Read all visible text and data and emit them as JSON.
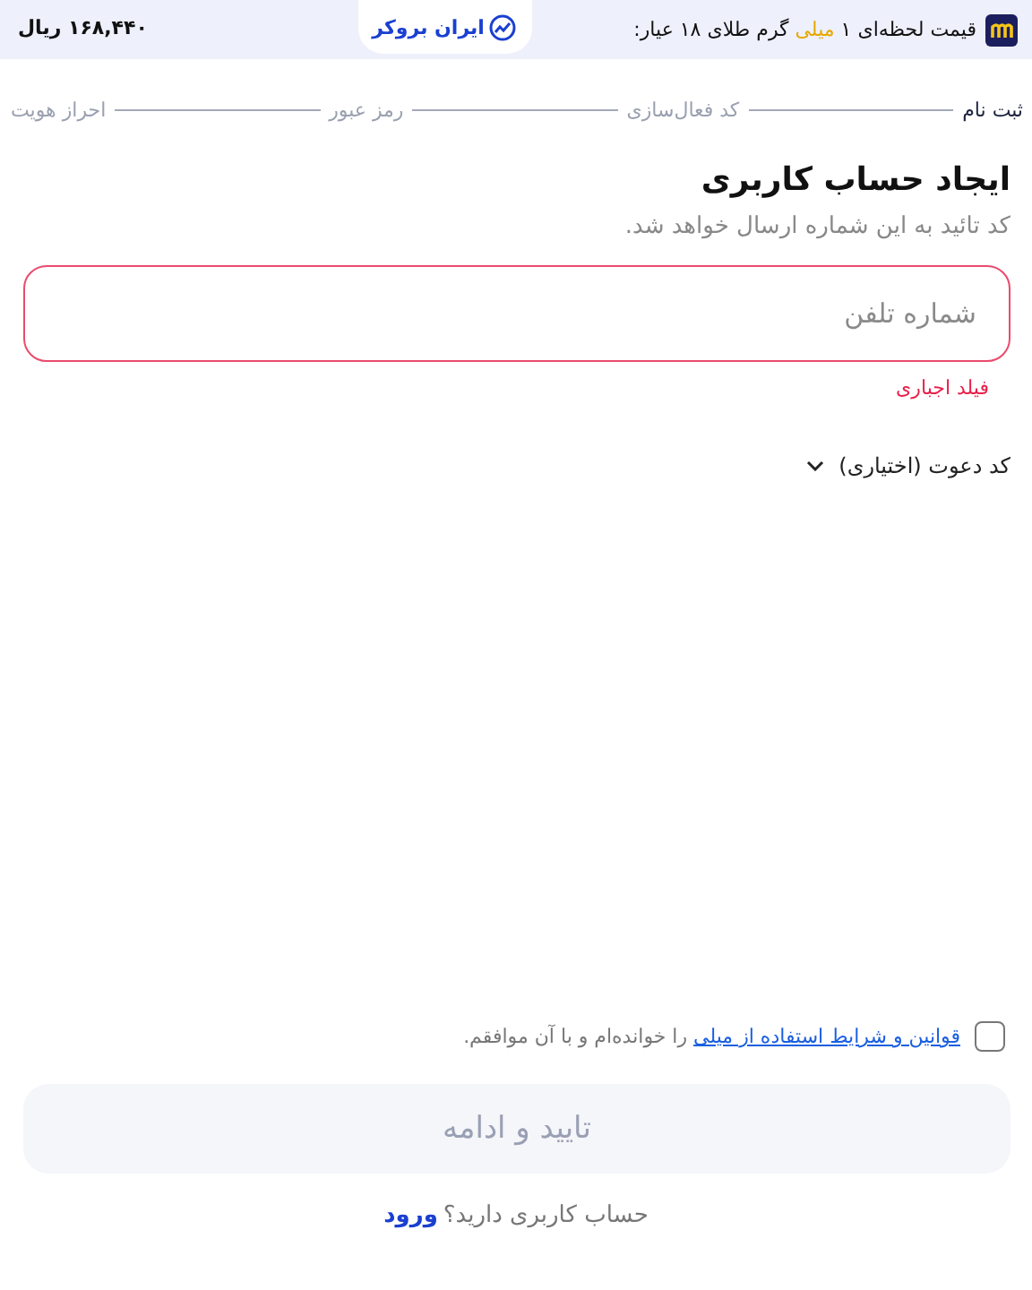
{
  "price_banner": {
    "label_before": "قیمت لحظه‌ای ۱ ",
    "label_highlight": "میلی",
    "label_after": " گرم طلای ۱۸ عیار:",
    "price": "۱۶۸,۴۴۰ ریال",
    "partner": "ایران بروکر"
  },
  "steps": [
    {
      "label": "ثبت نام",
      "selected": true
    },
    {
      "label": "کد فعال‌سازی",
      "selected": false
    },
    {
      "label": "رمز عبور",
      "selected": false
    },
    {
      "label": "احراز هویت",
      "selected": false
    }
  ],
  "title": "ایجاد حساب کاربری",
  "subtitle": "کد تائید به این شماره ارسال خواهد شد.",
  "phone_field": {
    "placeholder": "شماره تلفن",
    "error": "فیلد اجباری"
  },
  "invite_code": {
    "label": "کد دعوت (اختیاری)",
    "expanded": false
  },
  "terms": {
    "checked": false,
    "link": "قوانین و شرایط استفاده از میلی",
    "text": " را خوانده‌ام و با آن موافقم."
  },
  "submit": {
    "label": "تایید و ادامه",
    "disabled": true
  },
  "login_prompt": {
    "text": "حساب کاربری دارید؟",
    "link": "ورود"
  }
}
